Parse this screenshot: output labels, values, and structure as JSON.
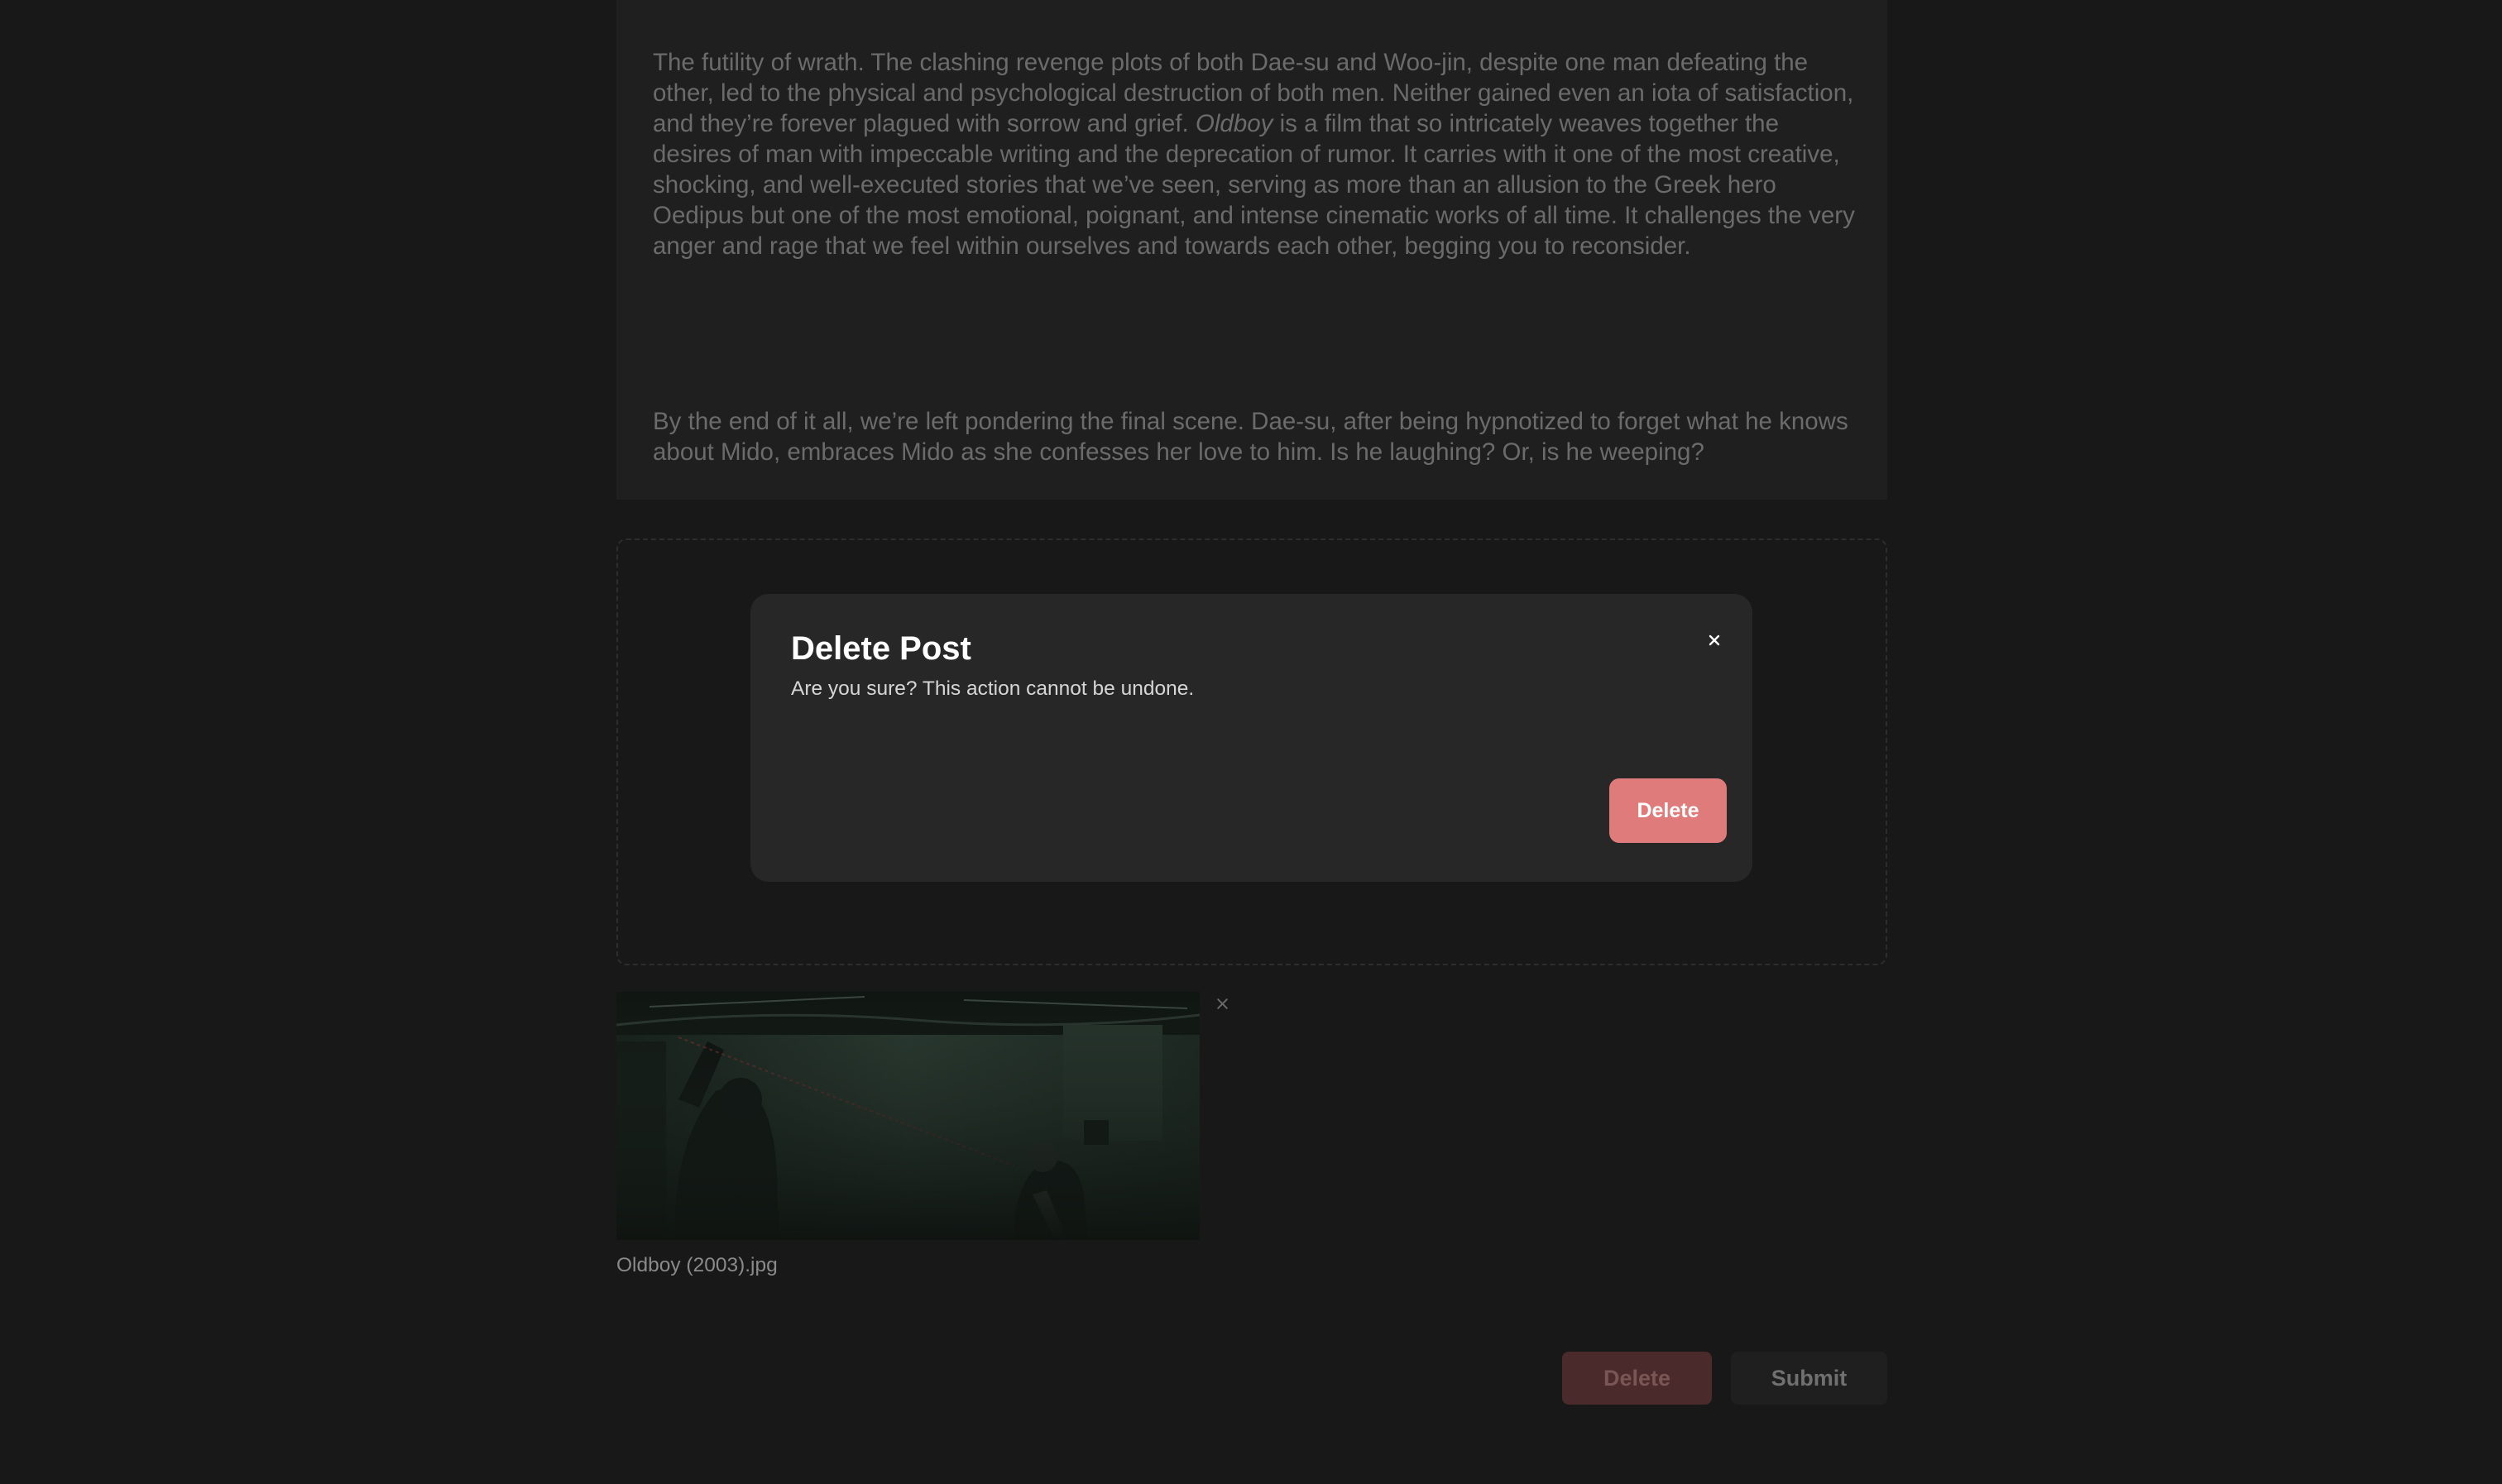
{
  "editor": {
    "paragraphs": [
      {
        "before": "The futility of wrath. The clashing revenge plots of both Dae-su and Woo-jin, despite one man defeating the other, led to the physical and psychological destruction of both men. Neither gained even an iota of satisfaction, and they’re forever plagued with sorrow and grief. ",
        "emphasis": "Oldboy",
        "after": " is a film that so intricately weaves together the desires of man with impeccable writing and the deprecation of rumor. It carries with it one of the most creative, shocking, and well-executed stories that we’ve seen, serving as more than an allusion to the Greek hero Oedipus but one of the most emotional, poignant, and intense cinematic works of all time. It challenges the very anger and rage that we feel within ourselves and towards each other, begging you to reconsider."
      },
      {
        "text": "By the end of it all, we’re left pondering the final scene. Dae-su, after being hypnotized to forget what he knows about Mido, embraces Mido as she confesses her love to him. Is he laughing? Or, is he weeping?"
      }
    ]
  },
  "modal": {
    "title": "Delete Post",
    "body": "Are you sure? This action cannot be undone.",
    "delete_label": "Delete",
    "close_icon": "close-icon"
  },
  "attachment": {
    "filename": "Oldboy (2003).jpg",
    "remove_icon": "close-icon"
  },
  "actions": {
    "delete_label": "Delete",
    "submit_label": "Submit"
  },
  "colors": {
    "background": "#181818",
    "panel": "#1f1f1f",
    "modal": "#272727",
    "danger": "#e07b7b",
    "danger_muted": "#4a2a2a"
  }
}
